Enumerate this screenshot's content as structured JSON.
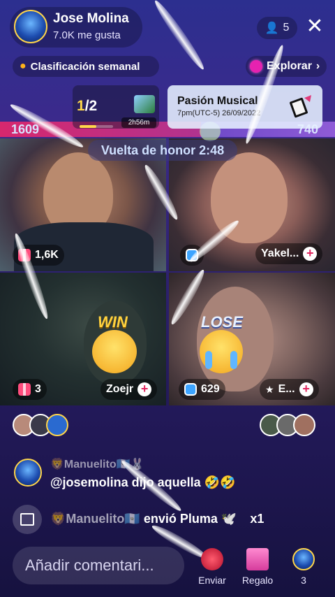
{
  "host": {
    "name": "Jose Molina",
    "likes": "7.0K me gusta"
  },
  "viewers": {
    "count": "5"
  },
  "ranking": {
    "icon": "flame-icon",
    "label": "Clasificación semanal"
  },
  "explore": {
    "label": "Explorar"
  },
  "round": {
    "current": "1",
    "total": "/2",
    "timer": "2h56m",
    "progress": 0.5
  },
  "event": {
    "title": "Pasión Musical",
    "time": "7pm(UTC-5) 26/09/2022"
  },
  "battle": {
    "score_left": "1609",
    "score_right": "740",
    "honor_lap": "Vuelta de honor 2:48",
    "win_label": "WIN",
    "lose_label": "LOSE"
  },
  "participants": [
    {
      "stat": "1,6K",
      "badge_icon": "gift-box-icon"
    },
    {
      "name": "Yakel...",
      "badge_icon": "shield-icon"
    },
    {
      "stat": "3",
      "name": "Zoejr",
      "badge_icon": "gift-box-icon"
    },
    {
      "stat": "629",
      "name": "E...",
      "badge_icon": "shield-icon"
    }
  ],
  "chat": {
    "messages": [
      {
        "user": "🦁Manuelito🇬🇹🐰",
        "text": "@josemolina dijo aquella 🤣🤣"
      }
    ],
    "gift_event": {
      "user": "🦁Manuelito🇬🇹",
      "text": "envió Pluma 🕊️",
      "multiplier": "x1"
    }
  },
  "bottom_bar": {
    "comment_placeholder": "Añadir comentari...",
    "send_label": "Enviar",
    "gift_label": "Regalo",
    "profile_count": "3"
  },
  "colors": {
    "accent_pink": "#d6286e",
    "accent_purple": "#6d49c8",
    "win_yellow": "#ffd23f",
    "plus_red": "#e0245e"
  }
}
